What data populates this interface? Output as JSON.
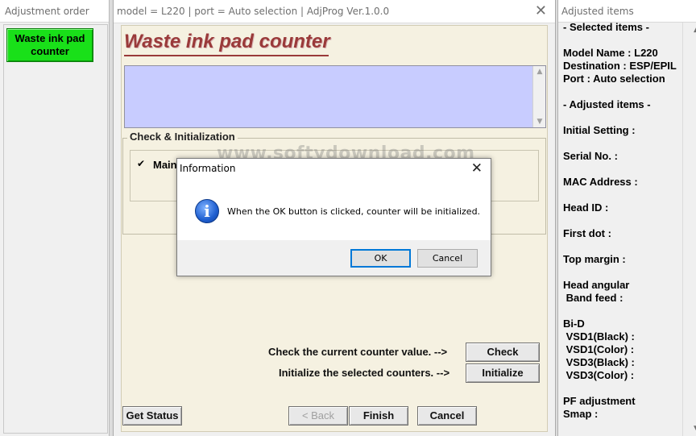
{
  "left_window": {
    "title": "Adjustment order",
    "button_label": "Waste ink pad counter"
  },
  "main_window": {
    "title": "model = L220 | port = Auto selection | AdjProg Ver.1.0.0",
    "close_glyph": "✕",
    "heading": "Waste ink pad counter",
    "group_label": "Check & Initialization",
    "checkbox_label": "Main",
    "watermark": "www.softydownload.com",
    "check_row_label": "Check the current counter value. -->",
    "check_button": "Check",
    "init_row_label": "Initialize the selected counters. -->",
    "init_button": "Initialize",
    "get_status_button": "Get Status",
    "back_button": "< Back",
    "finish_button": "Finish",
    "cancel_button": "Cancel"
  },
  "right_window": {
    "title": "Adjusted items",
    "lines": [
      "- Selected items -",
      "",
      "Model Name : L220",
      "Destination : ESP/EPIL",
      "Port : Auto selection",
      "",
      "- Adjusted items -",
      "",
      "Initial Setting :",
      "",
      "Serial No. :",
      "",
      "MAC Address :",
      "",
      "Head ID :",
      "",
      "First dot :",
      "",
      "Top margin :",
      "",
      "Head angular",
      " Band feed :",
      "",
      "Bi-D",
      " VSD1(Black) :",
      " VSD1(Color) :",
      " VSD3(Black) :",
      " VSD3(Color) :",
      "",
      "PF adjustment",
      "Smap :"
    ]
  },
  "dialog": {
    "title": "Information",
    "close_glyph": "✕",
    "icon": "info-icon",
    "icon_glyph": "i",
    "message": "When the OK button is clicked, counter will be initialized.",
    "ok_button": "OK",
    "cancel_button": "Cancel"
  },
  "colors": {
    "waste_button": "#19e019",
    "heading": "#9a3a3a",
    "panel_bg": "#f5f1e1",
    "blue_box": "#c8ccff",
    "info_icon": "#1f5fd0"
  }
}
